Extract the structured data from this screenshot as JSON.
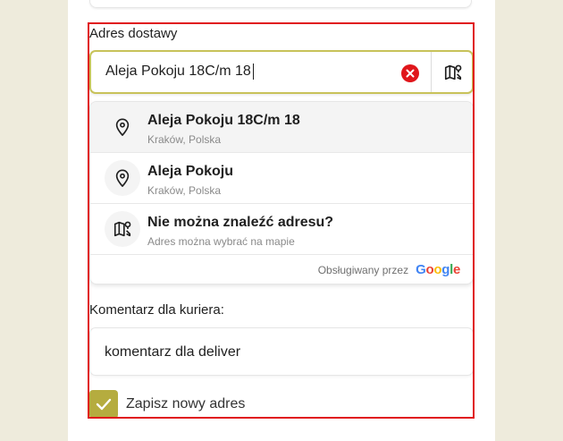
{
  "colors": {
    "accent": "#b5ac3f",
    "input_border": "#c8c25a",
    "error_red": "#e0161b",
    "page_bg": "#eeebdc"
  },
  "address": {
    "label": "Adres dostawy",
    "input_value": "Aleja Pokoju 18C/m 18",
    "clear_icon": "close-circle-icon",
    "map_icon": "map-pin-icon"
  },
  "suggestions": [
    {
      "title": "Aleja Pokoju 18C/m 18",
      "subtitle": "Kraków, Polska",
      "icon": "location-pin-icon"
    },
    {
      "title": "Aleja Pokoju",
      "subtitle": "Kraków, Polska",
      "icon": "location-pin-icon"
    },
    {
      "title": "Nie można znaleźć adresu?",
      "subtitle": "Adres można wybrać na mapie",
      "icon": "map-pin-icon"
    }
  ],
  "powered_by": {
    "text": "Obsługiwany przez",
    "brand": "Google"
  },
  "comment": {
    "label": "Komentarz dla kuriera:",
    "value": "komentarz dla deliver"
  },
  "save_address": {
    "label": "Zapisz nowy adres",
    "checked": true
  }
}
